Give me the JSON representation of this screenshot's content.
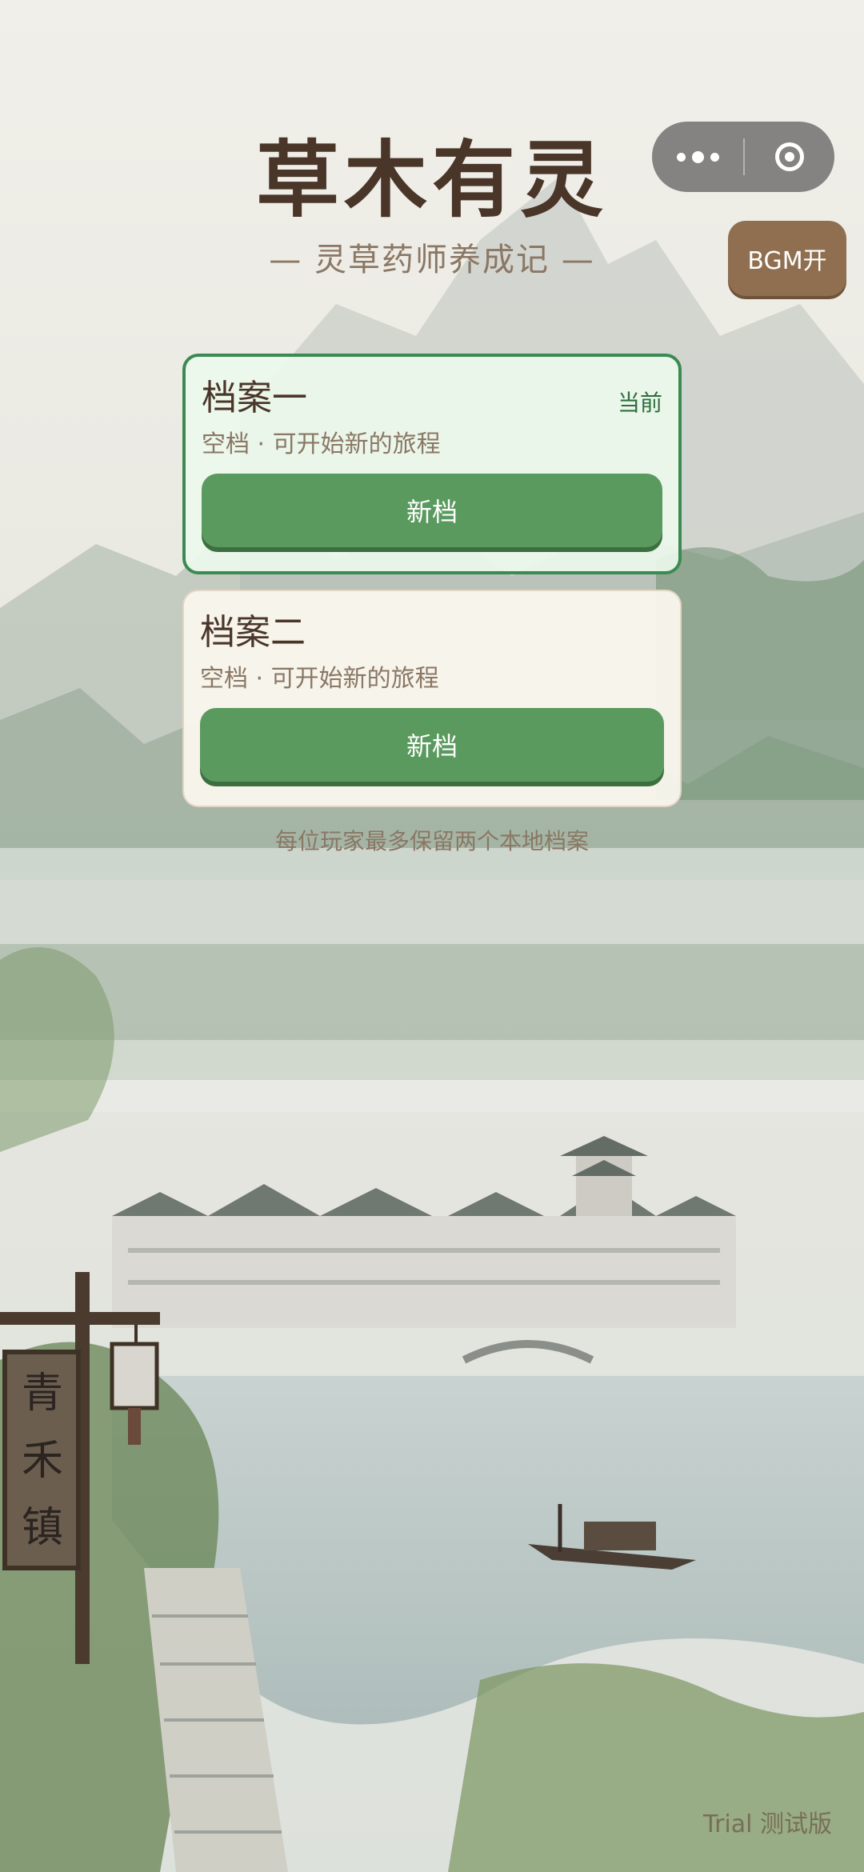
{
  "app": {
    "title": "草木有灵",
    "subtitle": "— 灵草药师养成记 —"
  },
  "capsule": {
    "more_icon": "more-dots-icon",
    "close_icon": "target-circle-icon"
  },
  "bgm_toggle": {
    "label": "BGM开"
  },
  "slots": [
    {
      "name": "档案一",
      "badge": "当前",
      "status": "空档 · 可开始新的旅程",
      "button": "新档"
    },
    {
      "name": "档案二",
      "status": "空档 · 可开始新的旅程",
      "button": "新档"
    }
  ],
  "note": "每位玩家最多保留两个本地档案",
  "signpost": {
    "text": "青禾镇"
  },
  "version_label": "Trial 测试版",
  "colors": {
    "title": "#4a3629",
    "accent_green": "#5a9a5e",
    "current_border": "#3b8a52",
    "bgm_button": "#8f6f50"
  }
}
